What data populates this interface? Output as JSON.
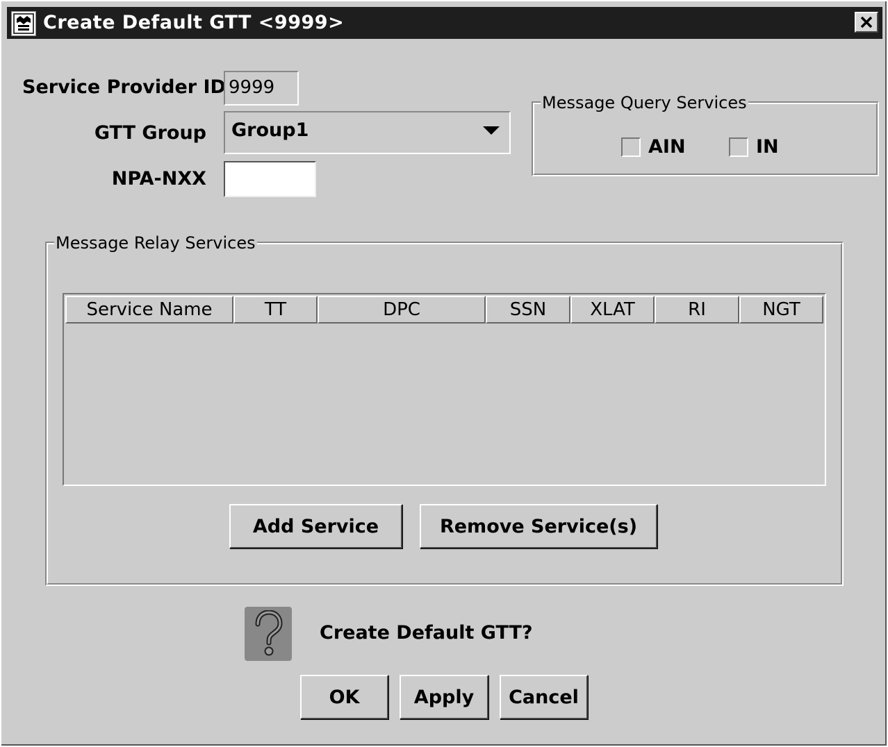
{
  "window": {
    "title": "Create Default GTT <9999>",
    "icons": {
      "app": "app-icon",
      "close": "close-icon"
    }
  },
  "form": {
    "service_provider_label": "Service Provider ID",
    "service_provider_value": "9999",
    "gtt_group_label": "GTT Group",
    "gtt_group_value": "Group1",
    "npa_nxx_label": "NPA-NXX",
    "npa_nxx_value": ""
  },
  "query_services": {
    "title": "Message Query Services",
    "options": [
      {
        "label": "AIN",
        "checked": false
      },
      {
        "label": "IN",
        "checked": false
      }
    ]
  },
  "relay_services": {
    "title": "Message Relay Services",
    "columns": [
      "Service Name",
      "TT",
      "DPC",
      "SSN",
      "XLAT",
      "RI",
      "NGT"
    ],
    "rows": [],
    "add_button": "Add Service",
    "remove_button": "Remove Service(s)"
  },
  "prompt": {
    "icon": "question-icon",
    "message": "Create Default GTT?"
  },
  "buttons": {
    "ok": "OK",
    "apply": "Apply",
    "cancel": "Cancel"
  }
}
